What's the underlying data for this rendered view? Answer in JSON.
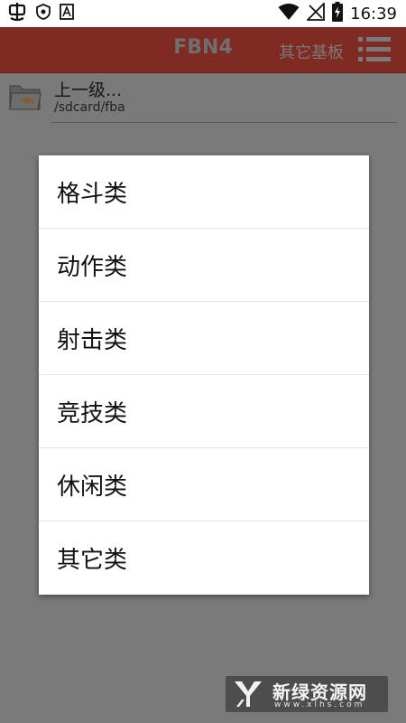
{
  "status_bar": {
    "time": "16:39",
    "icons": [
      "bug-icon",
      "shield-icon",
      "a-box-icon",
      "wifi-icon",
      "signal-icon",
      "battery-charging-icon"
    ]
  },
  "app_bar": {
    "title": "FBN4",
    "menu_label": "其它基板",
    "menu_icon": "list-menu-icon"
  },
  "file_list": {
    "items": [
      {
        "name": "上一级...",
        "path": "/sdcard/fba",
        "icon": "folder-back-icon"
      }
    ]
  },
  "dialog": {
    "options": [
      "格斗类",
      "动作类",
      "射击类",
      "竞技类",
      "休闲类",
      "其它类"
    ]
  },
  "watermark": {
    "title": "新绿资源网",
    "url": "www.xlhs.com"
  },
  "colors": {
    "app_bar": "#7f2a22",
    "overlay": "#7a7a7a",
    "dialog_bg": "#ffffff"
  }
}
